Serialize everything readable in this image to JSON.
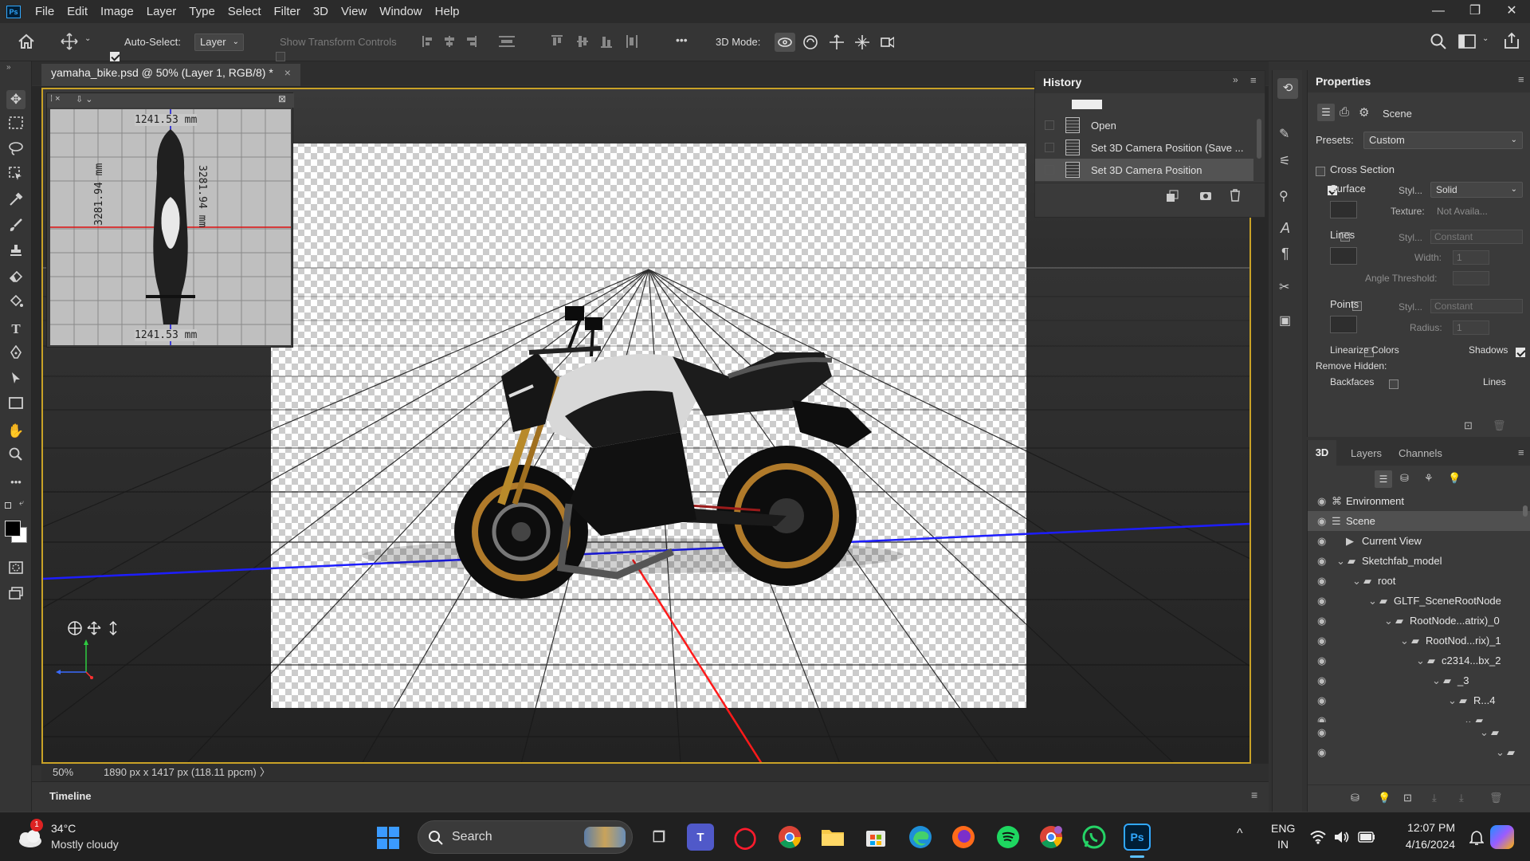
{
  "app": {
    "logo": "Ps"
  },
  "menu": [
    "File",
    "Edit",
    "Image",
    "Layer",
    "Type",
    "Select",
    "Filter",
    "3D",
    "View",
    "Window",
    "Help"
  ],
  "window_controls": {
    "minimize": "—",
    "restore": "❐",
    "close": "✕"
  },
  "options": {
    "auto_select_label": "Auto-Select:",
    "auto_select_checked": true,
    "layer_select": "Layer",
    "transform_controls_label": "Show Transform Controls",
    "more": "•••",
    "mode3d_label": "3D Mode:"
  },
  "document": {
    "tab_title": "yamaha_bike.psd @ 50% (Layer 1, RGB/8) *",
    "close": "×",
    "zoom": "50%",
    "doc_info": "1890 px x 1417 px (118.11 ppcm)",
    "info_arrow": "〉"
  },
  "secondary_view": {
    "dim_top": "1241.53 mm",
    "dim_bottom": "1241.53 mm",
    "dim_left": "3281.94 mm",
    "dim_right": "3281.94 mm"
  },
  "timeline": {
    "label": "Timeline"
  },
  "history": {
    "title": "History",
    "items": [
      "Open",
      "Set 3D Camera Position (Save ...",
      "Set 3D Camera Position"
    ],
    "selected_index": 2
  },
  "properties": {
    "title": "Properties",
    "tab_label": "Scene",
    "presets_label": "Presets:",
    "presets_value": "Custom",
    "cross_section": {
      "label": "Cross Section",
      "checked": false
    },
    "surface": {
      "label": "Surface",
      "checked": true,
      "style_label": "Styl...",
      "style_value": "Solid",
      "texture_label": "Texture:",
      "texture_value": "Not Availa..."
    },
    "lines": {
      "label": "Lines",
      "checked": false,
      "style_label": "Styl...",
      "style_value": "Constant",
      "width_label": "Width:",
      "width_value": "1",
      "angle_label": "Angle Threshold:"
    },
    "points": {
      "label": "Points",
      "checked": false,
      "style_label": "Styl...",
      "style_value": "Constant",
      "radius_label": "Radius:",
      "radius_value": "1"
    },
    "linearize": {
      "label": "Linearize Colors",
      "checked": false
    },
    "shadows": {
      "label": "Shadows",
      "checked": true
    },
    "remove_hidden_label": "Remove Hidden:",
    "backfaces": {
      "label": "Backfaces",
      "checked": false
    },
    "lines2": {
      "label": "Lines",
      "checked": true
    }
  },
  "panel3d": {
    "tabs": [
      "3D",
      "Layers",
      "Channels"
    ],
    "active_tab": 0,
    "tree": [
      {
        "label": "Environment",
        "indent": 0,
        "twisty": ""
      },
      {
        "label": "Scene",
        "indent": 0,
        "twisty": "",
        "selected": true
      },
      {
        "label": "Current View",
        "indent": 1,
        "twisty": ""
      },
      {
        "label": "Sketchfab_model",
        "indent": 1,
        "twisty": "⌄"
      },
      {
        "label": "root",
        "indent": 2,
        "twisty": "⌄"
      },
      {
        "label": "GLTF_SceneRootNode",
        "indent": 3,
        "twisty": "⌄"
      },
      {
        "label": "RootNode...atrix)_0",
        "indent": 4,
        "twisty": "⌄"
      },
      {
        "label": "RootNod...rix)_1",
        "indent": 5,
        "twisty": "⌄"
      },
      {
        "label": "c2314...bx_2",
        "indent": 6,
        "twisty": "⌄"
      },
      {
        "label": "_3",
        "indent": 7,
        "twisty": "⌄"
      },
      {
        "label": "R...4",
        "indent": 8,
        "twisty": "⌄"
      },
      {
        "label": "...",
        "indent": 9,
        "twisty": "⌄"
      },
      {
        "label": "",
        "indent": 10,
        "twisty": "⌄"
      },
      {
        "label": "",
        "indent": 11,
        "twisty": "⌄"
      }
    ]
  },
  "taskbar": {
    "weather_temp": "34°C",
    "weather_desc": "Mostly cloudy",
    "weather_badge": "1",
    "search_label": "Search",
    "lang_top": "ENG",
    "lang_bottom": "IN",
    "time": "12:07 PM",
    "date": "4/16/2024",
    "ps_label": "Ps",
    "caret": "^"
  },
  "colors": {
    "accent": "#31a8ff",
    "viewport_border": "#c9a227",
    "axis_blue": "#1d1dff",
    "axis_red": "#ff1a1a"
  }
}
